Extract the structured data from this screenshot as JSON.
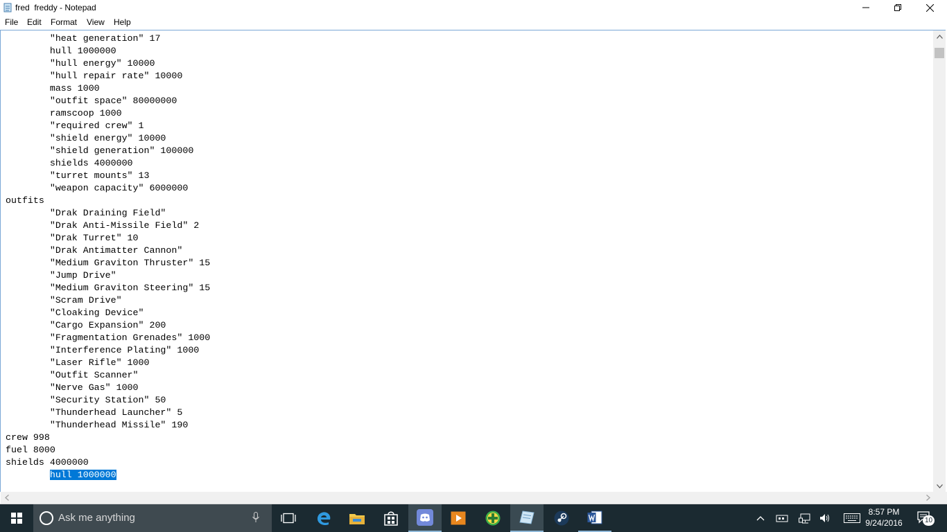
{
  "window": {
    "title": "fred  freddy - Notepad",
    "icon": "notepad-icon"
  },
  "menu": {
    "file": "File",
    "edit": "Edit",
    "format": "Format",
    "view": "View",
    "help": "Help"
  },
  "editor": {
    "lines": [
      "        \"heat generation\" 17",
      "        hull 1000000",
      "        \"hull energy\" 10000",
      "        \"hull repair rate\" 10000",
      "        mass 1000",
      "        \"outfit space\" 80000000",
      "        ramscoop 1000",
      "        \"required crew\" 1",
      "        \"shield energy\" 10000",
      "        \"shield generation\" 100000",
      "        shields 4000000",
      "        \"turret mounts\" 13",
      "        \"weapon capacity\" 6000000",
      "outfits",
      "        \"Drak Draining Field\"",
      "        \"Drak Anti-Missile Field\" 2",
      "        \"Drak Turret\" 10",
      "        \"Drak Antimatter Cannon\"",
      "        \"Medium Graviton Thruster\" 15",
      "        \"Jump Drive\"",
      "        \"Medium Graviton Steering\" 15",
      "        \"Scram Drive\"",
      "        \"Cloaking Device\"",
      "        \"Cargo Expansion\" 200",
      "        \"Fragmentation Grenades\" 1000",
      "        \"Interference Plating\" 1000",
      "        \"Laser Rifle\" 1000",
      "        \"Outfit Scanner\"",
      "        \"Nerve Gas\" 1000",
      "        \"Security Station\" 50",
      "        \"Thunderhead Launcher\" 5",
      "        \"Thunderhead Missile\" 190",
      "crew 998",
      "fuel 8000",
      "shields 4000000"
    ],
    "selected_line": "hull 1000000",
    "indent": "        ",
    "selection_color": "#0078d7"
  },
  "taskbar": {
    "search_placeholder": "Ask me anything",
    "time": "8:57 PM",
    "date": "9/24/2016",
    "notification_count": "10",
    "apps": [
      "task-view-icon",
      "edge-icon",
      "file-explorer-icon",
      "store-icon",
      "discord-icon",
      "media-player-icon",
      "plus-app-icon",
      "notepad-icon",
      "steam-icon",
      "word-icon"
    ],
    "tray": [
      "chevron-up-icon",
      "network-device-icon",
      "network-icon",
      "volume-icon",
      "keyboard-icon"
    ]
  }
}
